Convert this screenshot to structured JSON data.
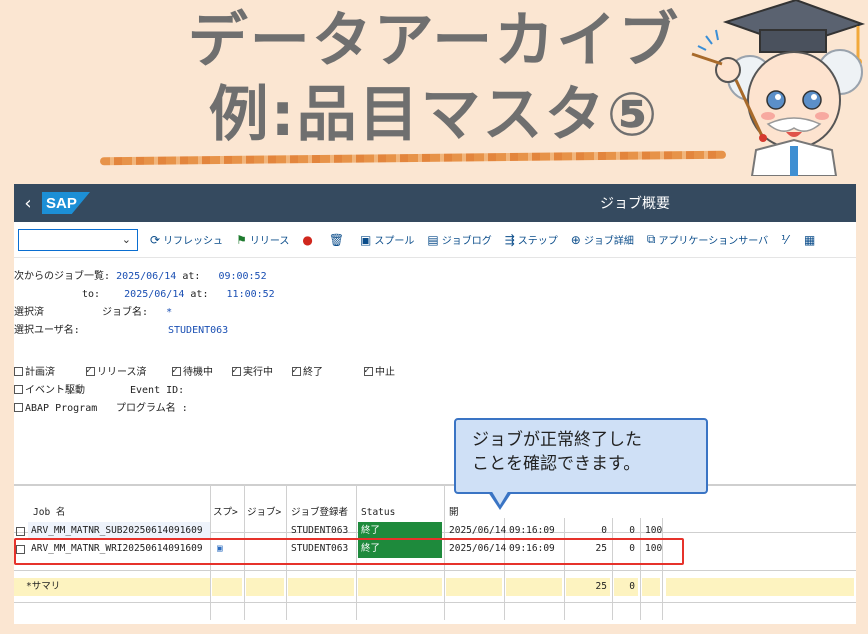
{
  "banner": {
    "line1": "データアーカイブ",
    "line2": "例:品目マスタ⑤"
  },
  "shell": {
    "back_icon": "‹",
    "logo": "SAP",
    "title": "ジョブ概要"
  },
  "toolbar": {
    "combo_value": "",
    "buttons": [
      {
        "icon": "⟳",
        "label": "リフレッシュ"
      },
      {
        "icon": "⚑",
        "label": "リリース"
      },
      {
        "icon": "●",
        "label": ""
      },
      {
        "icon": "🗑",
        "label": ""
      },
      {
        "icon": "▣",
        "label": "スプール"
      },
      {
        "icon": "▤",
        "label": "ジョブログ"
      },
      {
        "icon": "⇶",
        "label": "ステップ"
      },
      {
        "icon": "⊕",
        "label": "ジョブ詳細"
      },
      {
        "icon": "⧉",
        "label": "アプリケーションサーバ"
      },
      {
        "icon": "⅟",
        "label": ""
      },
      {
        "icon": "▦",
        "label": ""
      }
    ]
  },
  "criteria": {
    "from_label": "次からのジョブ一覧:",
    "from_date": "2025/06/14",
    "at_label": "at:",
    "from_time": "09:00:52",
    "to_label": "to:",
    "to_date": "2025/06/14",
    "to_time": "11:00:52",
    "selected_label": "選択済",
    "jobname_label": "ジョブ名:",
    "jobname_value": "*",
    "user_label": "選択ユーザ名:",
    "user_value": "STUDENT063"
  },
  "status_filters": [
    {
      "label": "計画済",
      "checked": false
    },
    {
      "label": "リリース済",
      "checked": true
    },
    {
      "label": "待機中",
      "checked": true
    },
    {
      "label": "実行中",
      "checked": true
    },
    {
      "label": "終了",
      "checked": true
    },
    {
      "label": "中止",
      "checked": true
    }
  ],
  "event": {
    "label": "イベント駆動",
    "event_id_label": "Event ID:"
  },
  "abap": {
    "label": "ABAP Program",
    "program_label": "プログラム名 :"
  },
  "grid": {
    "headers": [
      "Job 名",
      "スプ>",
      "ジョブ>",
      "ジョブ登録者",
      "Status",
      "開"
    ],
    "rows": [
      {
        "job": "ARV_MM_MATNR_SUB20250614091609",
        "spool": "",
        "creator": "STUDENT063",
        "status": "終了",
        "date": "2025/06/14",
        "time": "09:16:09",
        "n1": "0",
        "n2": "0",
        "n3": "100"
      },
      {
        "job": "ARV_MM_MATNR_WRI20250614091609",
        "spool": "▣",
        "creator": "STUDENT063",
        "status": "終了",
        "date": "2025/06/14",
        "time": "09:16:09",
        "n1": "25",
        "n2": "0",
        "n3": "100"
      }
    ],
    "summary": {
      "label": "*サマリ",
      "n1": "25",
      "n2": "0"
    }
  },
  "callout": {
    "line1": "ジョブが正常終了した",
    "line2": "ことを確認できます。"
  }
}
